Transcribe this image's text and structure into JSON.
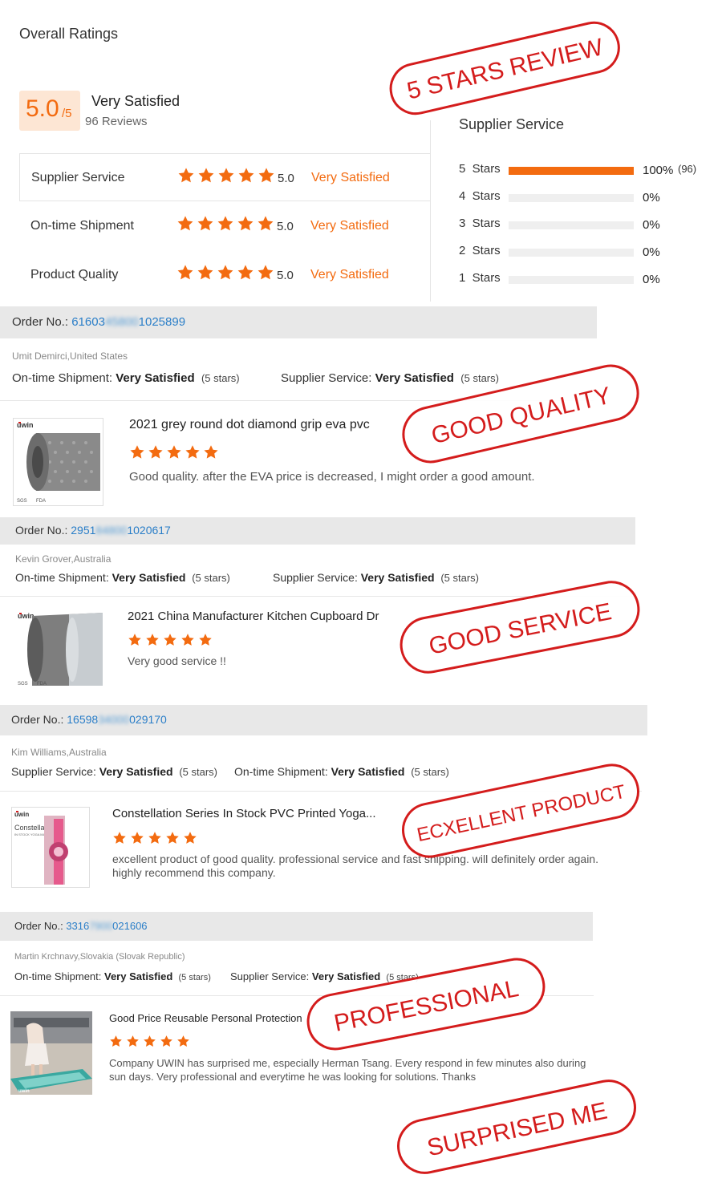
{
  "overall": {
    "title": "Overall Ratings",
    "score": "5.0",
    "score_suffix": "/5",
    "verdict": "Very Satisfied",
    "review_count": "96 Reviews",
    "metrics": [
      {
        "label": "Supplier Service",
        "score": "5.0",
        "verdict": "Very Satisfied",
        "stars": 5
      },
      {
        "label": "On-time Shipment",
        "score": "5.0",
        "verdict": "Very Satisfied",
        "stars": 5
      },
      {
        "label": "Product Quality",
        "score": "5.0",
        "verdict": "Very Satisfied",
        "stars": 5
      }
    ]
  },
  "distribution": {
    "title": "Supplier Service",
    "rows": [
      {
        "label": "5  Stars",
        "pct": "100%",
        "count": "(96)",
        "fraction": 1.0
      },
      {
        "label": "4  Stars",
        "pct": "0%",
        "count": "",
        "fraction": 0
      },
      {
        "label": "3  Stars",
        "pct": "0%",
        "count": "",
        "fraction": 0
      },
      {
        "label": "2  Stars",
        "pct": "0%",
        "count": "",
        "fraction": 0
      },
      {
        "label": "1  Stars",
        "pct": "0%",
        "count": "",
        "fraction": 0
      }
    ]
  },
  "reviews": [
    {
      "order_prefix": "Order No.:",
      "order_a": "61603",
      "order_hidden": "45800",
      "order_b": "1025899",
      "buyer": "Umit Demirci,United States",
      "sat1_label": "On-time Shipment:",
      "sat1_value": "Very Satisfied",
      "sat1_stars": "(5 stars)",
      "sat2_label": "Supplier Service:",
      "sat2_value": "Very Satisfied",
      "sat2_stars": "(5 stars)",
      "product_title": "2021 grey round dot diamond grip eva pvc",
      "review_text": "Good quality. after the EVA price is decreased, I might order a good amount.",
      "stars": 5
    },
    {
      "order_prefix": "Order No.:",
      "order_a": "2951",
      "order_hidden": "84800",
      "order_b": "1020617",
      "buyer": "Kevin Grover,Australia",
      "sat1_label": "On-time Shipment:",
      "sat1_value": "Very Satisfied",
      "sat1_stars": "(5 stars)",
      "sat2_label": "Supplier Service:",
      "sat2_value": "Very Satisfied",
      "sat2_stars": "(5 stars)",
      "product_title": "2021 China Manufacturer Kitchen Cupboard Dr",
      "review_text": "Very good service !!",
      "stars": 5
    },
    {
      "order_prefix": "Order No.:",
      "order_a": "16598",
      "order_hidden": "34000",
      "order_b": "029170",
      "buyer": "Kim Williams,Australia",
      "sat1_label": "Supplier Service:",
      "sat1_value": "Very Satisfied",
      "sat1_stars": "(5 stars)",
      "sat2_label": "On-time Shipment:",
      "sat2_value": "Very Satisfied",
      "sat2_stars": "(5 stars)",
      "product_title": "Constellation Series In Stock PVC Printed Yoga...",
      "review_text": "excellent product of good quality. professional service and fast shipping. will definitely order again. highly recommend this company.",
      "stars": 5
    },
    {
      "order_prefix": "Order No.:",
      "order_a": "3316",
      "order_hidden": "7900",
      "order_b": "021606",
      "buyer": "Martin Krchnavy,Slovakia (Slovak Republic)",
      "sat1_label": "On-time Shipment:",
      "sat1_value": "Very Satisfied",
      "sat1_stars": "(5 stars)",
      "sat2_label": "Supplier Service:",
      "sat2_value": "Very Satisfied",
      "sat2_stars": "(5 stars)",
      "product_title": "Good Price Reusable Personal Protection",
      "review_text": "Company UWIN has surprised me, especially Herman Tsang. Every respond in few minutes also during sun days. Very professional and everytime he was looking for solutions. Thanks",
      "stars": 5
    }
  ],
  "thumbs": {
    "brand": "uwin",
    "badge_a": "SGS",
    "badge_b": "FDA",
    "constellation_label": "Constellation",
    "constellation_sub": "IN STOCK YOGA MAT"
  },
  "stamps": [
    "5 STARS REVIEW",
    "GOOD QUALITY",
    "GOOD SERVICE",
    "ECXELLENT PRODUCT",
    "PROFESSIONAL",
    "SURPRISED ME"
  ],
  "colors": {
    "accent": "#f36b10",
    "link": "#2a7ec8",
    "stamp": "#d41c1c"
  }
}
